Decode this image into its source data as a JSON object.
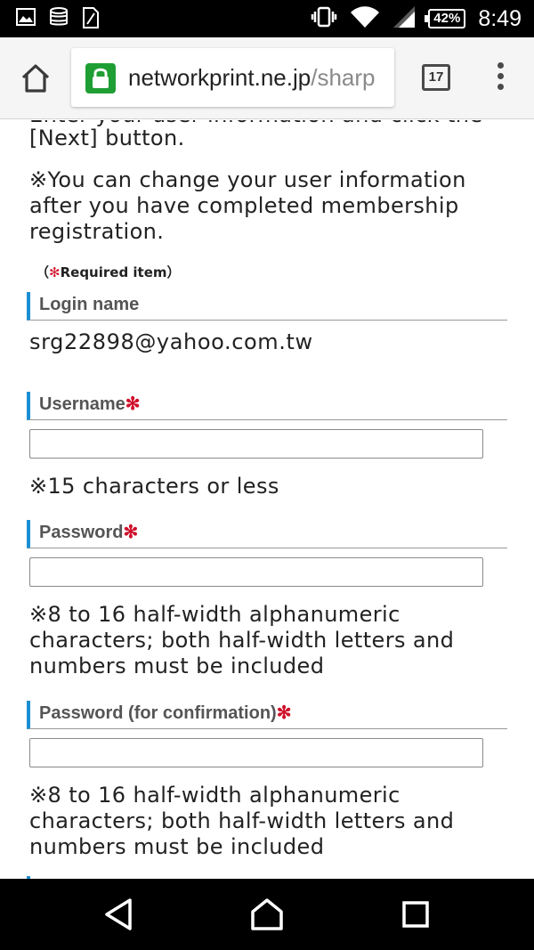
{
  "status_bar": {
    "battery": "42%",
    "time": "8:49",
    "icons": [
      "image-icon",
      "database-icon",
      "sim-icon",
      "vibrate-icon",
      "wifi-icon",
      "signal-icon",
      "battery-icon"
    ]
  },
  "browser": {
    "url_host": "networkprint.ne.jp",
    "url_path": "/sharp",
    "tab_count": "17",
    "lock_color": "#1f9e34"
  },
  "page": {
    "cut_line": "Enter your user information and click the",
    "instruction_line": "[Next] button.",
    "note_change": "※You can change your user information after you have completed membership registration.",
    "required_open": "（",
    "required_star": "✻",
    "required_text": "Required item",
    "required_close": "）",
    "login_label": "Login name",
    "login_value": "srg22898@yahoo.com.tw",
    "username_label": "Username",
    "username_value": "",
    "username_hint": "※15 characters or less",
    "password_label": "Password",
    "password_value": "",
    "password_hint": "※8 to 16 half-width alphanumeric characters; both half-width letters and numbers must be included",
    "confirm_label": "Password (for confirmation)",
    "confirm_value": "",
    "confirm_hint": "※8 to 16 half-width alphanumeric characters; both half-width letters and numbers must be included",
    "required_mark": "✻"
  },
  "colors": {
    "accent_bar": "#1b8fd3",
    "required": "#d0112b"
  }
}
